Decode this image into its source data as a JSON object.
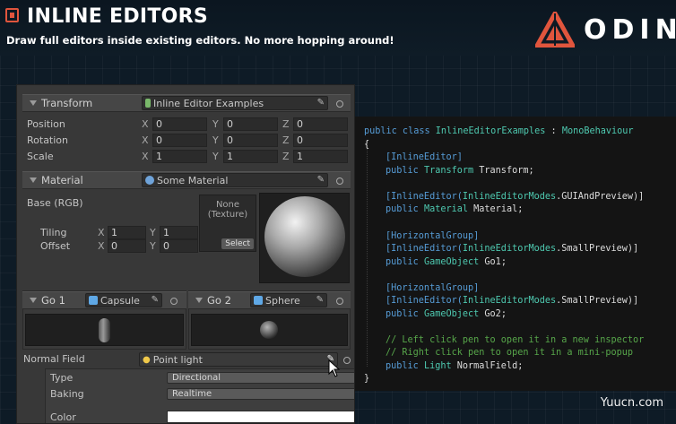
{
  "header": {
    "title": "INLINE EDITORS",
    "subtitle": "Draw full editors inside existing editors. No more hopping around!",
    "brand": "ODIN",
    "brand_color": "#e0553d"
  },
  "inspector": {
    "transform": {
      "title": "Transform",
      "object": "Inline Editor Examples",
      "rows": [
        {
          "label": "Position",
          "x": "0",
          "y": "0",
          "z": "0"
        },
        {
          "label": "Rotation",
          "x": "0",
          "y": "0",
          "z": "0"
        },
        {
          "label": "Scale",
          "x": "1",
          "y": "1",
          "z": "1"
        }
      ],
      "axes": {
        "x": "X",
        "y": "Y",
        "z": "Z"
      }
    },
    "material": {
      "title": "Material",
      "object": "Some Material",
      "base_label": "Base (RGB)",
      "texture_none": "None",
      "texture_type": "(Texture)",
      "select_label": "Select",
      "tiling_label": "Tiling",
      "tiling_x": "1",
      "tiling_y": "1",
      "offset_label": "Offset",
      "offset_x": "0",
      "offset_y": "0"
    },
    "go1": {
      "title": "Go 1",
      "object": "Capsule"
    },
    "go2": {
      "title": "Go 2",
      "object": "Sphere"
    },
    "normal_field": {
      "label": "Normal Field",
      "object": "Point light",
      "type_label": "Type",
      "type_value": "Directional",
      "baking_label": "Baking",
      "baking_value": "Realtime",
      "color_label": "Color"
    }
  },
  "code": {
    "l1_kw": "public class ",
    "l1_type": "InlineEditorExamples",
    "l1_sep": " : ",
    "l1_base": "MonoBehaviour",
    "l2": "{",
    "l3_attr": "[InlineEditor]",
    "l4_kw": "public ",
    "l4_type": "Transform",
    "l4_name": " Transform;",
    "l6_attr1": "[InlineEditor(",
    "l6_attr2": "InlineEditorModes",
    "l6_attr3": ".GUIAndPreview)]",
    "l7_kw": "public ",
    "l7_type": "Material",
    "l7_name": " Material;",
    "l9_attr": "[HorizontalGroup]",
    "l10_attr1": "[InlineEditor(",
    "l10_attr2": "InlineEditorModes",
    "l10_attr3": ".SmallPreview)]",
    "l11_kw": "public ",
    "l11_type": "GameObject",
    "l11_name": " Go1;",
    "l13_attr": "[HorizontalGroup]",
    "l14_attr1": "[InlineEditor(",
    "l14_attr2": "InlineEditorModes",
    "l14_attr3": ".SmallPreview)]",
    "l15_kw": "public ",
    "l15_type": "GameObject",
    "l15_name": " Go2;",
    "l17_comment": "// Left click pen to open it in a new inspector",
    "l18_comment": "// Right click pen to open it in a mini-popup",
    "l19_kw": "public ",
    "l19_type": "Light",
    "l19_name": " NormalField;",
    "l20": "}"
  },
  "watermark": "Yuucn.com"
}
